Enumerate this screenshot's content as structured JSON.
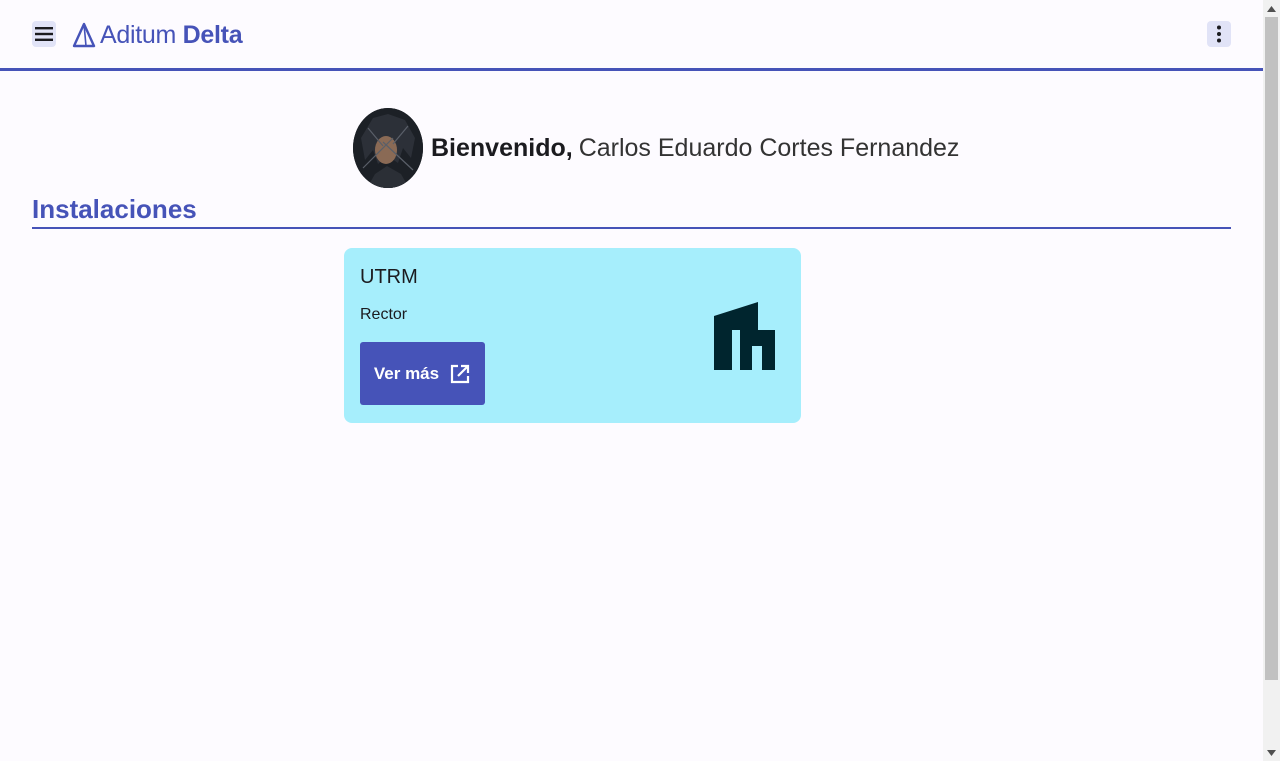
{
  "header": {
    "menu_icon": "hamburger-menu-icon",
    "logo": {
      "icon": "triangle-logo-icon",
      "name_light": "Aditum",
      "name_bold": "Delta"
    },
    "more_icon": "more-vertical-icon"
  },
  "welcome": {
    "greeting": "Bienvenido,",
    "user_name": "Carlos Eduardo Cortes Fernandez"
  },
  "section": {
    "title": "Instalaciones"
  },
  "installations": [
    {
      "name": "UTRM",
      "role": "Rector",
      "button_label": "Ver más",
      "button_icon": "external-link-icon",
      "card_icon": "building-icon"
    }
  ],
  "colors": {
    "primary": "#4653b8",
    "card_bg": "#a6eefc",
    "page_bg": "#fdfbff"
  }
}
